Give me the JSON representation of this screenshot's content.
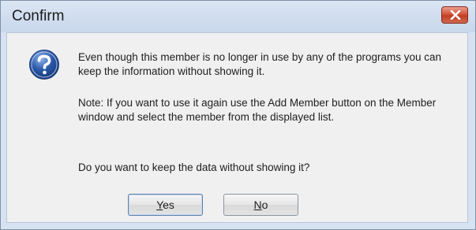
{
  "window": {
    "title": "Confirm"
  },
  "icons": {
    "close": "close-icon",
    "question": "question-icon"
  },
  "colors": {
    "titlebar": "#cfdcee",
    "close_button": "#c94a30",
    "question_icon": "#2a58a8"
  },
  "message": {
    "paragraph1": "Even though this member is no longer in use by any of the programs you can keep the information without showing it.",
    "paragraph2": "Note: If you want to use it again use the Add Member button on the Member window and select the member from the displayed list.",
    "paragraph3": "Do you want to keep the data without showing it?"
  },
  "buttons": {
    "yes_mnemonic": "Y",
    "yes_rest": "es",
    "no_mnemonic": "N",
    "no_rest": "o"
  }
}
